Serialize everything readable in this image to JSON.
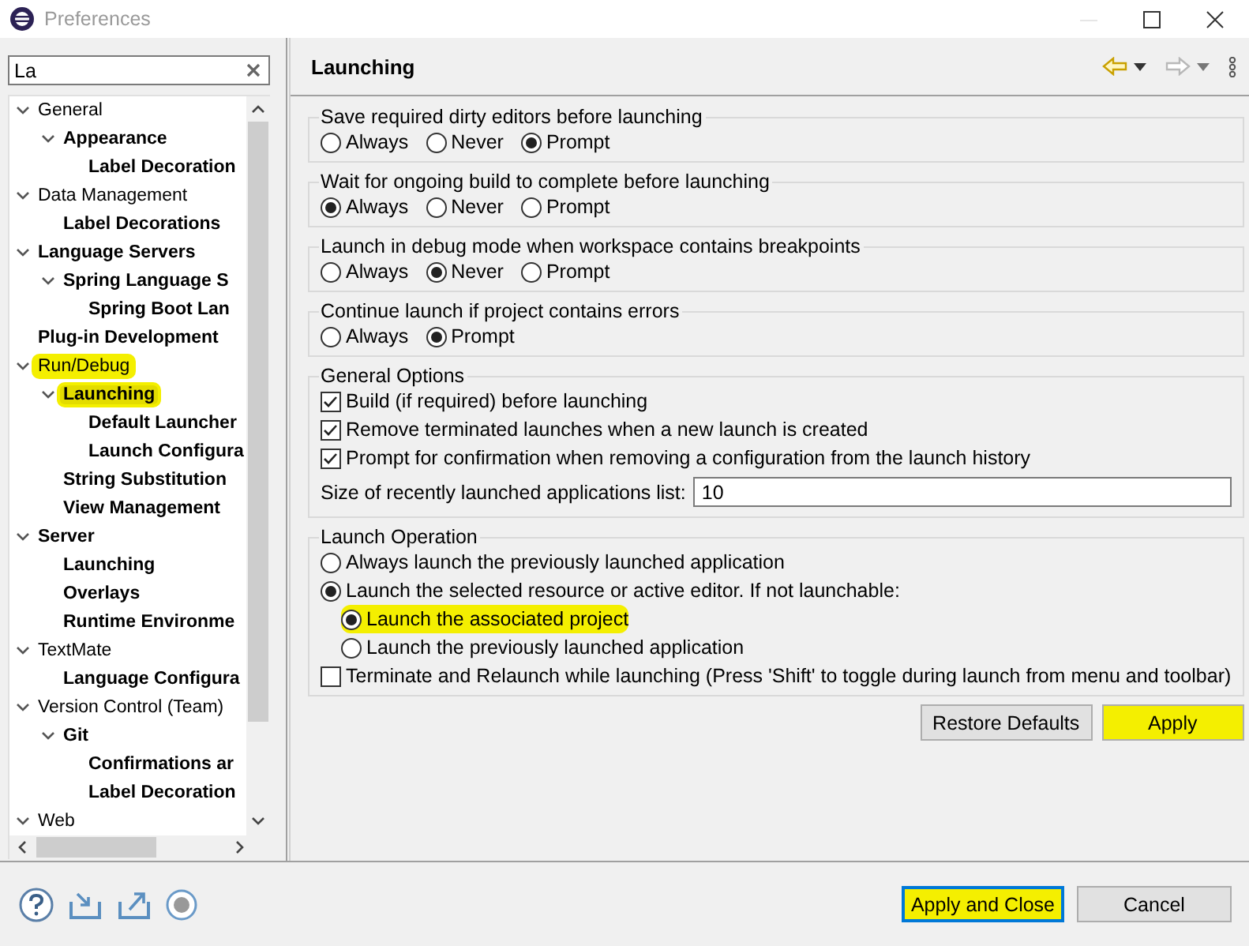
{
  "window": {
    "title": "Preferences"
  },
  "filter": {
    "value": "La"
  },
  "tree": [
    {
      "label": "General",
      "matched": false,
      "expanded": true,
      "selected": false,
      "highlighted": false,
      "children": [
        {
          "label": "Appearance",
          "matched": true,
          "expanded": true,
          "selected": false,
          "highlighted": false,
          "children": [
            {
              "label": "Label Decoration",
              "matched": true,
              "selected": false,
              "highlighted": false
            }
          ]
        }
      ]
    },
    {
      "label": "Data Management",
      "matched": false,
      "expanded": true,
      "selected": false,
      "highlighted": false,
      "children": [
        {
          "label": "Label Decorations",
          "matched": true,
          "selected": false,
          "highlighted": false
        }
      ]
    },
    {
      "label": "Language Servers",
      "matched": true,
      "expanded": true,
      "selected": false,
      "highlighted": false,
      "children": [
        {
          "label": "Spring Language S",
          "matched": true,
          "expanded": true,
          "selected": false,
          "highlighted": false,
          "children": [
            {
              "label": "Spring Boot Lan",
              "matched": true,
              "selected": false,
              "highlighted": false
            }
          ]
        }
      ]
    },
    {
      "label": "Plug-in Development",
      "matched": true,
      "selected": false,
      "highlighted": false
    },
    {
      "label": "Run/Debug",
      "matched": false,
      "expanded": true,
      "selected": false,
      "highlighted": true,
      "children": [
        {
          "label": "Launching",
          "matched": true,
          "expanded": true,
          "selected": true,
          "highlighted": true,
          "children": [
            {
              "label": "Default Launcher",
              "matched": true,
              "selected": false,
              "highlighted": false
            },
            {
              "label": "Launch Configura",
              "matched": true,
              "selected": false,
              "highlighted": false
            }
          ]
        },
        {
          "label": "String Substitution",
          "matched": true,
          "selected": false,
          "highlighted": false
        },
        {
          "label": "View Management",
          "matched": true,
          "selected": false,
          "highlighted": false
        }
      ]
    },
    {
      "label": "Server",
      "matched": true,
      "expanded": true,
      "selected": false,
      "highlighted": false,
      "children": [
        {
          "label": "Launching",
          "matched": true,
          "selected": false,
          "highlighted": false
        },
        {
          "label": "Overlays",
          "matched": true,
          "selected": false,
          "highlighted": false
        },
        {
          "label": "Runtime Environme",
          "matched": true,
          "selected": false,
          "highlighted": false
        }
      ]
    },
    {
      "label": "TextMate",
      "matched": false,
      "expanded": true,
      "selected": false,
      "highlighted": false,
      "children": [
        {
          "label": "Language Configura",
          "matched": true,
          "selected": false,
          "highlighted": false
        }
      ]
    },
    {
      "label": "Version Control (Team)",
      "matched": false,
      "expanded": true,
      "selected": false,
      "highlighted": false,
      "children": [
        {
          "label": "Git",
          "matched": true,
          "expanded": true,
          "selected": false,
          "highlighted": false,
          "children": [
            {
              "label": "Confirmations ar",
              "matched": true,
              "selected": false,
              "highlighted": false
            },
            {
              "label": "Label Decoration",
              "matched": true,
              "selected": false,
              "highlighted": false
            }
          ]
        }
      ]
    },
    {
      "label": "Web",
      "matched": false,
      "expanded": true,
      "selected": false,
      "highlighted": false
    }
  ],
  "page": {
    "title": "Launching",
    "groups": [
      {
        "title": "Save required dirty editors before launching",
        "kind": "radio-row",
        "options": [
          {
            "label": "Always",
            "selected": false
          },
          {
            "label": "Never",
            "selected": false
          },
          {
            "label": "Prompt",
            "selected": true
          }
        ]
      },
      {
        "title": "Wait for ongoing build to complete before launching",
        "kind": "radio-row",
        "options": [
          {
            "label": "Always",
            "selected": true
          },
          {
            "label": "Never",
            "selected": false
          },
          {
            "label": "Prompt",
            "selected": false
          }
        ]
      },
      {
        "title": "Launch in debug mode when workspace contains breakpoints",
        "kind": "radio-row",
        "options": [
          {
            "label": "Always",
            "selected": false
          },
          {
            "label": "Never",
            "selected": true
          },
          {
            "label": "Prompt",
            "selected": false
          }
        ]
      },
      {
        "title": "Continue launch if project contains errors",
        "kind": "radio-row",
        "options": [
          {
            "label": "Always",
            "selected": false
          },
          {
            "label": "Prompt",
            "selected": true
          }
        ]
      },
      {
        "title": "General Options",
        "kind": "stack",
        "items": [
          {
            "kind": "checkbox",
            "label": "Build (if required) before launching",
            "checked": true
          },
          {
            "kind": "checkbox",
            "label": "Remove terminated launches when a new launch is created",
            "checked": true
          },
          {
            "kind": "checkbox",
            "label": "Prompt for confirmation when removing a configuration from the launch history",
            "checked": true
          },
          {
            "kind": "field",
            "label": "Size of recently launched applications list:",
            "value": "10"
          }
        ]
      },
      {
        "title": "Launch Operation",
        "kind": "stack",
        "items": [
          {
            "kind": "radio",
            "label": "Always launch the previously launched application",
            "selected": false
          },
          {
            "kind": "radio",
            "label": "Launch the selected resource or active editor. If not launchable:",
            "selected": true,
            "children": [
              {
                "label": "Launch the associated project",
                "selected": true,
                "highlighted": true
              },
              {
                "label": "Launch the previously launched application",
                "selected": false,
                "highlighted": false
              }
            ]
          },
          {
            "kind": "checkbox",
            "label": "Terminate and Relaunch while launching (Press 'Shift' to toggle during launch from menu and toolbar)",
            "checked": false
          }
        ]
      }
    ],
    "buttons": [
      {
        "label": "Restore Defaults",
        "highlighted": false
      },
      {
        "label": "Apply",
        "highlighted": true
      }
    ]
  },
  "footer_buttons": [
    {
      "label": "Apply and Close",
      "default": true,
      "highlighted": true
    },
    {
      "label": "Cancel",
      "default": false,
      "highlighted": false
    }
  ]
}
